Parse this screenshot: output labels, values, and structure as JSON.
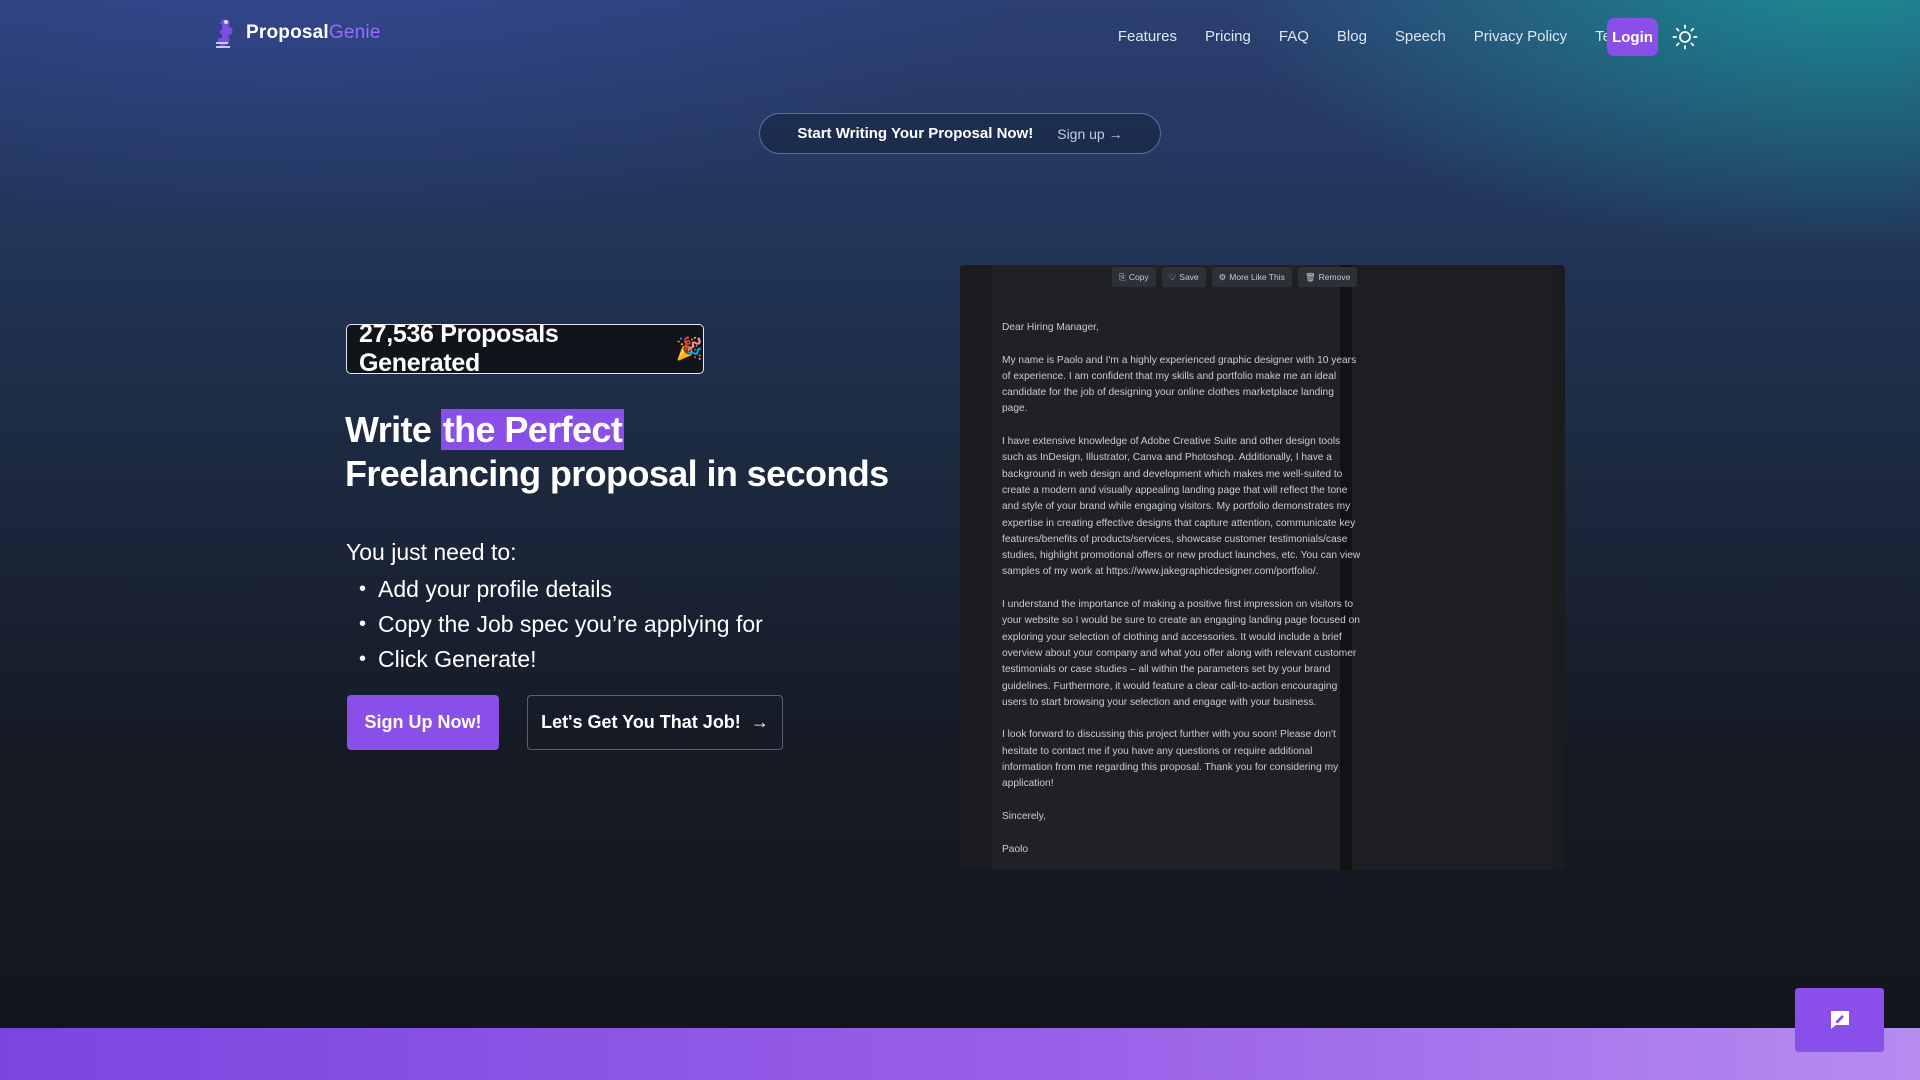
{
  "brand": {
    "name_part1": "Proposal",
    "name_part2": "Genie"
  },
  "nav": {
    "links": [
      "Features",
      "Pricing",
      "FAQ",
      "Blog",
      "Speech",
      "Privacy Policy",
      "Terms"
    ],
    "login_label": "Login",
    "theme_icon": "sun-icon"
  },
  "banner": {
    "title": "Start Writing Your Proposal Now!",
    "link": "Sign up →"
  },
  "hero": {
    "counter": "27,536 Proposals Generated",
    "counter_emoji": "🎉",
    "headline_prefix": "Write ",
    "headline_highlight": "the Perfect",
    "headline_line2": "Freelancing proposal in seconds",
    "need_label": "You just need to:",
    "steps": [
      "Add your profile details",
      "Copy the Job spec you’re applying for",
      "Click Generate!"
    ],
    "primary_button": "Sign Up Now!",
    "secondary_button": "Let's Get You That Job!",
    "secondary_arrow": "→"
  },
  "preview": {
    "toolbar": [
      {
        "label": "Copy",
        "icon": "⎘"
      },
      {
        "label": "Save",
        "icon": "♡"
      },
      {
        "label": "More Like This",
        "icon": "⚙"
      },
      {
        "label": "Remove",
        "icon": "🗑"
      }
    ],
    "letter": [
      "Dear Hiring Manager,",
      "My name is Paolo and I'm a highly experienced graphic designer with 10 years of experience. I am confident that my skills and portfolio make me an ideal candidate for the job of designing your online clothes marketplace landing page.",
      "I have extensive knowledge of Adobe Creative Suite and other design tools such as InDesign, Illustrator, Canva and Photoshop. Additionally, I have a background in web design and development which makes me well-suited to create a modern and visually appealing landing page that will reflect the tone and style of your brand while engaging visitors. My portfolio demonstrates my expertise in creating effective designs that capture attention, communicate key features/benefits of products/services, showcase customer testimonials/case studies, highlight promotional offers or new product launches, etc. You can view samples of my work at https://www.jakegraphicdesigner.com/portfolio/.",
      "I understand the importance of making a positive first impression on visitors to your website so I would be sure to create an engaging landing page focused on exploring your selection of clothing and accessories. It would include a brief overview about your company and what you offer along with relevant customer testimonials or case studies – all within the parameters set by your brand guidelines. Furthermore, it would feature a clear call-to-action encouraging users to start browsing your selection and engage with your business.",
      "I look forward to discussing this project further with you soon! Please don't hesitate to contact me if you have any questions or require additional information from me regarding this proposal. Thank you for considering my application!",
      "Sincerely,",
      "Paolo"
    ]
  },
  "colors": {
    "accent": "#8a4fe8",
    "bg_dark": "#12151b"
  }
}
